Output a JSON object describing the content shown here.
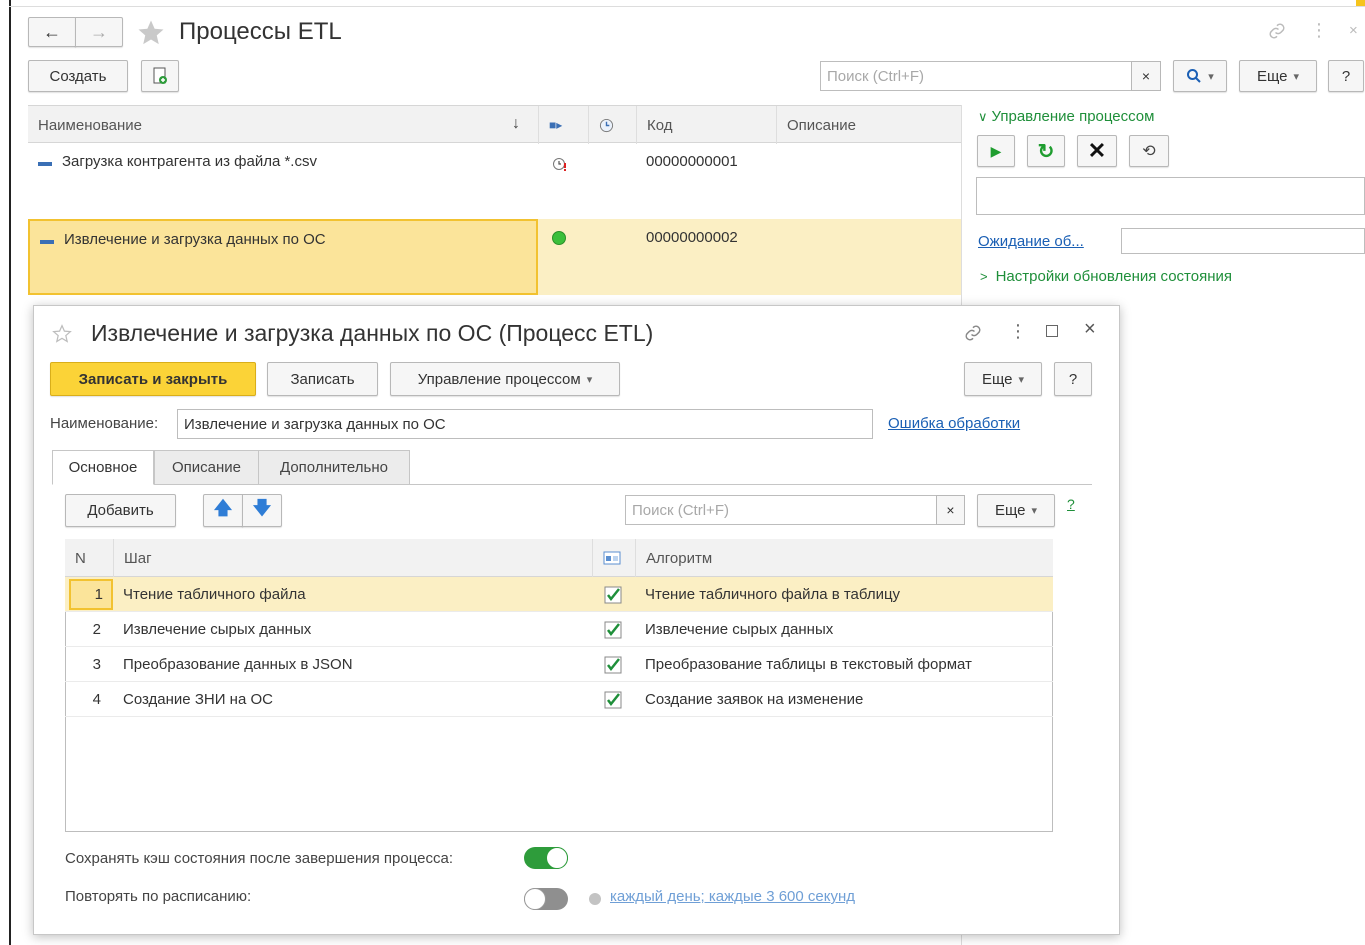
{
  "window": {
    "title": "Процессы ETL",
    "nav_back": "←",
    "nav_forward": "→"
  },
  "toolbar": {
    "create_label": "Создать",
    "search_placeholder": "Поиск (Ctrl+F)",
    "more_label": "Еще",
    "help_label": "?"
  },
  "list": {
    "columns": {
      "name": "Наименование",
      "code": "Код",
      "description": "Описание"
    },
    "rows": [
      {
        "name": "Загрузка контрагента из файла *.csv",
        "code": "00000000001",
        "description": ""
      },
      {
        "name": "Извлечение и загрузка данных по ОС",
        "code": "00000000002",
        "description": ""
      }
    ]
  },
  "side_panel": {
    "process_control_title": "Управление процессом",
    "waiting_link": "Ожидание об...",
    "update_settings_title": "Настройки обновления состояния"
  },
  "dialog": {
    "title": "Извлечение и загрузка данных по ОС (Процесс ETL)",
    "save_close_label": "Записать и закрыть",
    "save_label": "Записать",
    "process_control_label": "Управление процессом",
    "more_label": "Еще",
    "help_label": "?",
    "name_label": "Наименование:",
    "name_value": "Извлечение и загрузка данных по ОС",
    "error_link": "Ошибка обработки",
    "tabs": [
      "Основное",
      "Описание",
      "Дополнительно"
    ],
    "add_label": "Добавить",
    "search_placeholder": "Поиск (Ctrl+F)",
    "search_clear": "×",
    "more_label2": "Еще",
    "help_label2": "?",
    "grid": {
      "columns": {
        "n": "N",
        "step": "Шаг",
        "algorithm": "Алгоритм"
      },
      "rows": [
        {
          "n": "1",
          "step": "Чтение табличного файла",
          "algorithm": "Чтение табличного файла в таблицу"
        },
        {
          "n": "2",
          "step": "Извлечение сырых данных",
          "algorithm": "Извлечение сырых данных"
        },
        {
          "n": "3",
          "step": "Преобразование данных в JSON",
          "algorithm": "Преобразование таблицы в текстовый формат"
        },
        {
          "n": "4",
          "step": "Создание ЗНИ на ОС",
          "algorithm": "Создание заявок на изменение"
        }
      ]
    },
    "cache_label": "Сохранять кэш состояния после завершения процесса:",
    "cache_enabled": true,
    "schedule_label": "Повторять по расписанию:",
    "schedule_enabled": false,
    "schedule_link": "каждый день; каждые 3 600 секунд"
  },
  "colors": {
    "accent_yellow": "#fbd337",
    "green": "#1f8f3a",
    "link": "#1a5fb4",
    "selection": "#fbefc4"
  }
}
